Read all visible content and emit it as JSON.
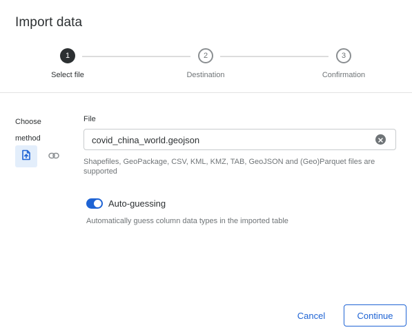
{
  "dialog": {
    "title": "Import data"
  },
  "stepper": {
    "steps": [
      {
        "number": "1",
        "label": "Select file",
        "state": "active"
      },
      {
        "number": "2",
        "label": "Destination",
        "state": "inactive"
      },
      {
        "number": "3",
        "label": "Confirmation",
        "state": "inactive"
      }
    ]
  },
  "method": {
    "label": "Choose method",
    "options": [
      {
        "icon": "file-upload-icon",
        "selected": true
      },
      {
        "icon": "link-icon",
        "selected": false
      }
    ]
  },
  "file": {
    "label": "File",
    "value": "covid_china_world.geojson",
    "help": "Shapefiles, GeoPackage, CSV, KML, KMZ, TAB, GeoJSON and (Geo)Parquet files are supported"
  },
  "auto_guessing": {
    "label": "Auto-guessing",
    "enabled": true,
    "help": "Automatically guess column data types in the imported table"
  },
  "footer": {
    "cancel_label": "Cancel",
    "continue_label": "Continue"
  },
  "colors": {
    "accent": "#1e63d4",
    "text": "#2c3032",
    "muted": "#6f7477",
    "selected_bg": "#e3eefb"
  }
}
